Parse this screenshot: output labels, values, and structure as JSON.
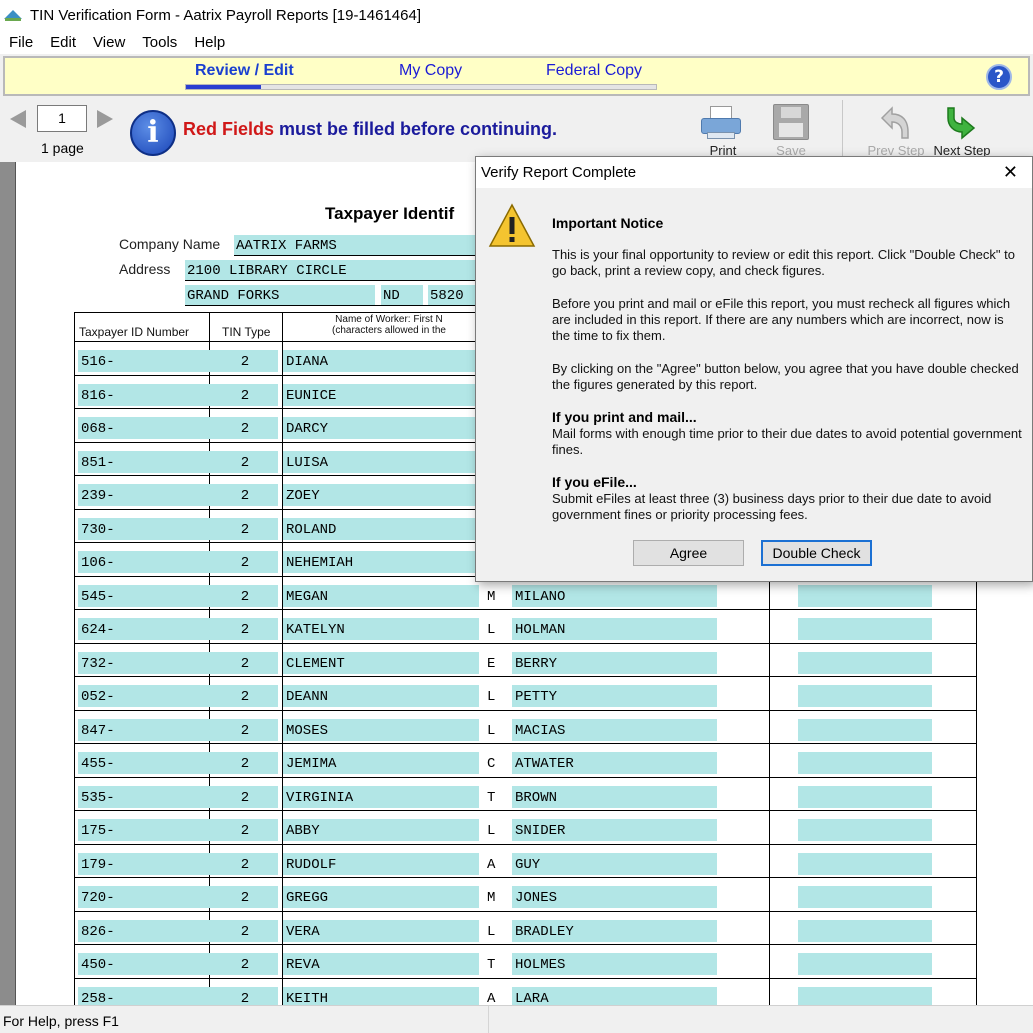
{
  "window": {
    "title": "TIN Verification Form - Aatrix Payroll Reports [19-1461464]"
  },
  "menu": [
    "File",
    "Edit",
    "View",
    "Tools",
    "Help"
  ],
  "steps": {
    "review": "Review / Edit",
    "my_copy": "My Copy",
    "federal": "Federal Copy",
    "progress_fraction": 0.16
  },
  "help_glyph": "?",
  "toolbar": {
    "page_number": "1",
    "page_count": "1 page",
    "notice_red": "Red Fields",
    "notice_rest": " must be filled before continuing.",
    "print": "Print",
    "save": "Save",
    "prev_step": "Prev Step",
    "next_step": "Next Step"
  },
  "form": {
    "title": "Taxpayer Identif",
    "company_label": "Company Name",
    "address_label": "Address",
    "company_name": "AATRIX FARMS",
    "address1": "2100 LIBRARY CIRCLE",
    "city": "GRAND FORKS",
    "state": "ND",
    "zip": "5820",
    "headers": {
      "tin": "Taxpayer ID Number",
      "tin_type": "TIN Type",
      "name_line1": "Name of Worker: First N",
      "name_line2": "(characters  allowed  in  the"
    },
    "rows": [
      {
        "tin": "516-",
        "type": "2",
        "first": "DIANA",
        "mi": "",
        "last": ""
      },
      {
        "tin": "816-",
        "type": "2",
        "first": "EUNICE",
        "mi": "",
        "last": ""
      },
      {
        "tin": "068-",
        "type": "2",
        "first": "DARCY",
        "mi": "",
        "last": ""
      },
      {
        "tin": "851-",
        "type": "2",
        "first": "LUISA",
        "mi": "",
        "last": ""
      },
      {
        "tin": "239-",
        "type": "2",
        "first": "ZOEY",
        "mi": "",
        "last": ""
      },
      {
        "tin": "730-",
        "type": "2",
        "first": "ROLAND",
        "mi": "",
        "last": ""
      },
      {
        "tin": "106-",
        "type": "2",
        "first": "NEHEMIAH",
        "mi": "",
        "last": ""
      },
      {
        "tin": "545-",
        "type": "2",
        "first": "MEGAN",
        "mi": "M",
        "last": "MILANO"
      },
      {
        "tin": "624-",
        "type": "2",
        "first": "KATELYN",
        "mi": "L",
        "last": "HOLMAN"
      },
      {
        "tin": "732-",
        "type": "2",
        "first": "CLEMENT",
        "mi": "E",
        "last": "BERRY"
      },
      {
        "tin": "052-",
        "type": "2",
        "first": "DEANN",
        "mi": "L",
        "last": "PETTY"
      },
      {
        "tin": "847-",
        "type": "2",
        "first": "MOSES",
        "mi": "L",
        "last": "MACIAS"
      },
      {
        "tin": "455-",
        "type": "2",
        "first": "JEMIMA",
        "mi": "C",
        "last": "ATWATER"
      },
      {
        "tin": "535-",
        "type": "2",
        "first": "VIRGINIA",
        "mi": "T",
        "last": "BROWN"
      },
      {
        "tin": "175-",
        "type": "2",
        "first": "ABBY",
        "mi": "L",
        "last": "SNIDER"
      },
      {
        "tin": "179-",
        "type": "2",
        "first": "RUDOLF",
        "mi": "A",
        "last": "GUY"
      },
      {
        "tin": "720-",
        "type": "2",
        "first": "GREGG",
        "mi": "M",
        "last": "JONES"
      },
      {
        "tin": "826-",
        "type": "2",
        "first": "VERA",
        "mi": "L",
        "last": "BRADLEY"
      },
      {
        "tin": "450-",
        "type": "2",
        "first": "REVA",
        "mi": "T",
        "last": "HOLMES"
      },
      {
        "tin": "258-",
        "type": "2",
        "first": "KEITH",
        "mi": "A",
        "last": "LARA"
      }
    ]
  },
  "dialog": {
    "title": "Verify Report Complete",
    "close_glyph": "✕",
    "heading": "Important Notice",
    "para1": "This is your final opportunity to review or edit this report. Click \"Double Check\" to go back, print a review copy, and check figures.",
    "para2": "Before you print and mail or eFile this report, you must recheck all figures which are included in this report.  If there are any numbers which are incorrect, now is the time to fix them.",
    "para3": "By clicking on the \"Agree\" button below, you agree that you have double checked the figures generated by this report.",
    "sub1": "If you print and mail...",
    "para4": "Mail forms with enough time prior to their due dates to avoid potential government fines.",
    "sub2": "If you eFile...",
    "para5": "Submit eFiles at least three (3) business days prior to their due date to avoid government fines or priority processing fees.",
    "agree": "Agree",
    "double_check": "Double Check"
  },
  "status": {
    "text": "For Help, press F1"
  },
  "colors": {
    "field_bg": "#b2e6e6",
    "step_bar_bg": "#ffffc6",
    "notice_red": "#d01818",
    "notice_blue": "#1b1b9c",
    "default_button_border": "#1b70d3"
  }
}
